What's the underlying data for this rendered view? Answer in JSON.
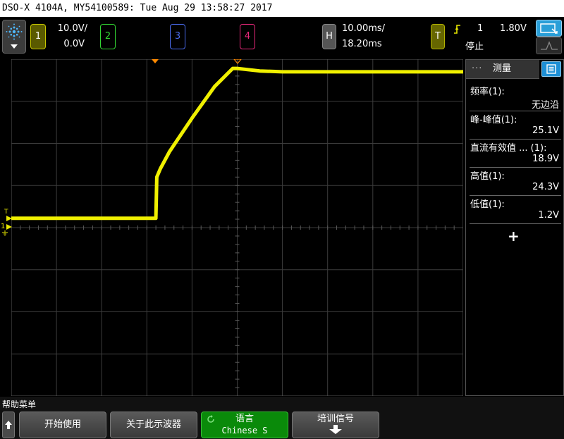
{
  "title_bar": "DSO-X 4104A, MY54100589: Tue Aug 29 13:58:27 2017",
  "channels": [
    {
      "number": "1",
      "scale": "10.0V/",
      "offset": "0.0V",
      "color": "#e8e800"
    },
    {
      "number": "2",
      "color": "#33d633"
    },
    {
      "number": "3",
      "color": "#4a6cf0"
    },
    {
      "number": "4",
      "color": "#e8287a"
    }
  ],
  "horizontal": {
    "label": "H",
    "time_per_div": "10.00ms/",
    "delay": "18.20ms"
  },
  "trigger": {
    "label": "T",
    "edge_icon": "rising-edge-icon",
    "source": "1",
    "level": "1.80V",
    "status": "停止"
  },
  "waveform": {
    "channel": "1",
    "color": "#f0f000",
    "marker_label": "1",
    "trigger_level_label": "T",
    "samples": [
      [
        -0.2,
        0.12
      ],
      [
        3.2,
        0.12
      ],
      [
        3.22,
        1.1
      ],
      [
        3.3,
        1.3
      ],
      [
        3.5,
        1.7
      ],
      [
        4.0,
        2.5
      ],
      [
        4.5,
        3.25
      ],
      [
        4.9,
        3.68
      ],
      [
        5.0,
        3.68
      ],
      [
        5.5,
        3.62
      ],
      [
        6.0,
        3.6
      ],
      [
        8.0,
        3.6
      ],
      [
        10.2,
        3.6
      ]
    ]
  },
  "panel": {
    "tab_label": "测量",
    "tab_dots": "···",
    "measurements": [
      {
        "label": "频率(1):",
        "value": "无边沿"
      },
      {
        "label": "峰-峰值(1):",
        "value": "25.1V"
      },
      {
        "label": "直流有效值 ... (1):",
        "value": "18.9V"
      },
      {
        "label": "高值(1):",
        "value": "24.3V"
      },
      {
        "label": "低值(1):",
        "value": "1.2V"
      }
    ],
    "add_label": "+"
  },
  "help": {
    "title": "帮助菜单",
    "buttons": [
      {
        "label": "开始使用"
      },
      {
        "label": "关于此示波器"
      },
      {
        "label": "语言",
        "sub": "Chinese S",
        "active": true
      },
      {
        "label": "培训信号"
      }
    ]
  }
}
